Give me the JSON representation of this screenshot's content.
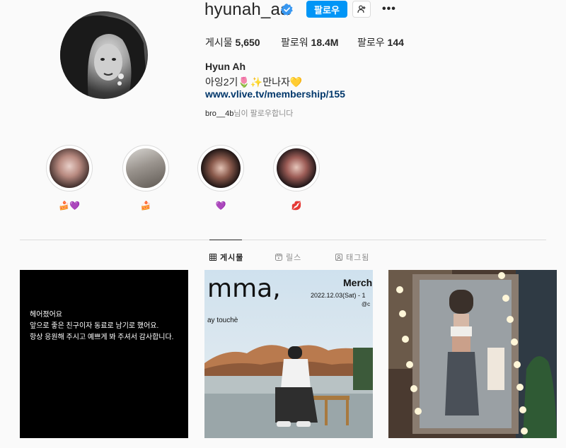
{
  "profile": {
    "username": "hyunah_aa",
    "follow_label": "팔로우",
    "more_label": "•••",
    "stats": {
      "posts_label": "게시물",
      "posts_value": "5,650",
      "followers_label": "팔로워",
      "followers_value": "18.4M",
      "following_label": "팔로우",
      "following_value": "144"
    },
    "full_name": "Hyun Ah",
    "bio": "아잉2기🌷✨만나자💛",
    "link": "www.vlive.tv/membership/155",
    "followed_by_user": "bro__4b",
    "followed_by_suffix": "님이 팔로우합니다"
  },
  "highlights": [
    {
      "label": "🍰💜"
    },
    {
      "label": "🍰"
    },
    {
      "label": "💜"
    },
    {
      "label": "💋"
    }
  ],
  "tabs": [
    {
      "label": "게시물",
      "icon": "grid-icon",
      "active": true
    },
    {
      "label": "릴스",
      "icon": "reels-icon",
      "active": false
    },
    {
      "label": "태그됨",
      "icon": "tag-icon",
      "active": false
    }
  ],
  "posts": [
    {
      "lines": [
        "헤어졌어요",
        "앞으로 좋은 친구이자 동료로 남기로 했어요.",
        "항상 응원해 주시고 예쁘게 봐 주셔서 감사합니다."
      ]
    },
    {
      "title": "mma,",
      "merch": "Merch",
      "date": "2022.12.03(Sat) - 1",
      "handle": "@c",
      "subtitle": "ay touchè"
    },
    {}
  ],
  "colors": {
    "accent": "#0095f6",
    "link": "#00376b",
    "verified": "#3897f0"
  }
}
